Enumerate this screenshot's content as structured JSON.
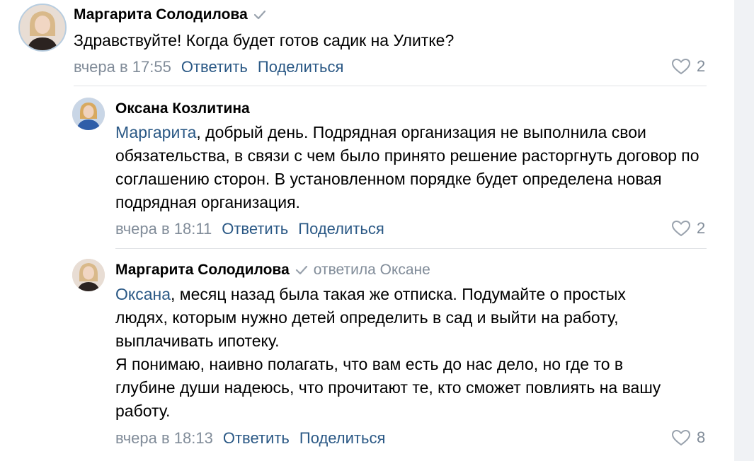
{
  "comments": [
    {
      "author": "Маргарита Солодилова",
      "verified": true,
      "reply_to": "",
      "mention": "",
      "text_rest": "Здравствуйте! Когда будет готов садик на Улитке?",
      "time": "вчера в 17:55",
      "reply_label": "Ответить",
      "share_label": "Поделиться",
      "likes": "2"
    },
    {
      "author": "Оксана Козлитина",
      "verified": false,
      "reply_to": "",
      "mention": "Маргарита",
      "text_rest": ", добрый день. Подрядная организация не выполнила свои обязательства, в связи с чем было принято решение расторгнуть договор по соглашению сторон. В установленном порядке будет определена новая подрядная организация.",
      "time": "вчера в 18:11",
      "reply_label": "Ответить",
      "share_label": "Поделиться",
      "likes": "2"
    },
    {
      "author": "Маргарита Солодилова",
      "verified": true,
      "reply_to": "ответила Оксане",
      "mention": "Оксана",
      "text_rest": ", месяц назад была такая же отписка. Подумайте о простых людях, которым нужно детей определить в сад и выйти на работу, выплачивать ипотеку.",
      "text_second": "Я понимаю, наивно полагать, что вам есть до нас дело, но где то в глубине души надеюсь, что прочитают те, кто сможет повлиять на вашу работу.",
      "time": "вчера в 18:13",
      "reply_label": "Ответить",
      "share_label": "Поделиться",
      "likes": "8"
    }
  ],
  "colors": {
    "link": "#2a5885",
    "muted": "#818c99",
    "divider": "#e1e3e6",
    "gutter": "#f0f2f5"
  },
  "icons": {
    "verified": "check-icon",
    "like": "heart-icon"
  }
}
